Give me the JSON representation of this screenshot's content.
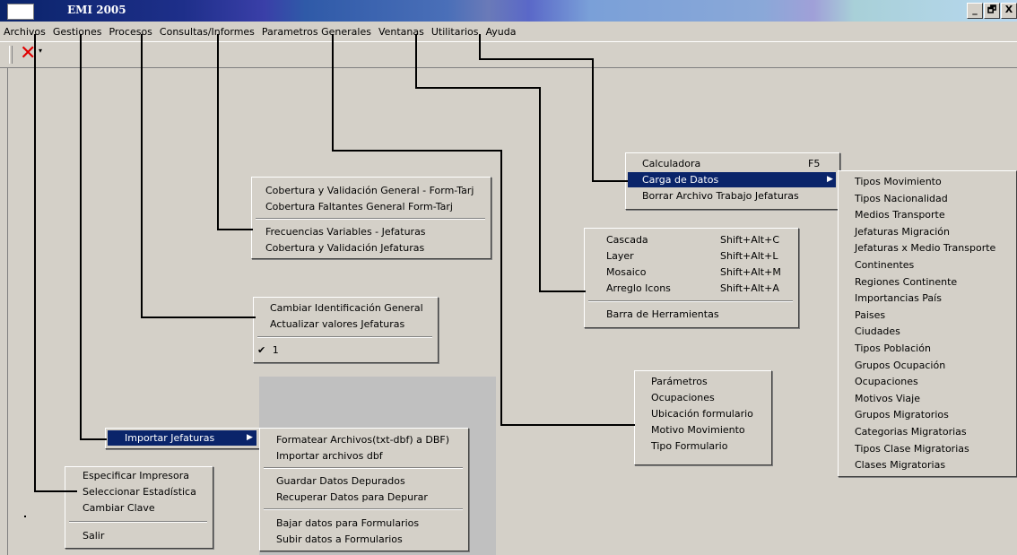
{
  "window": {
    "title": "EMI 2005",
    "buttons": [
      "_",
      "🗗",
      "X"
    ]
  },
  "menubar": [
    "Archivos",
    "Gestiones",
    "Procesos",
    "Consultas/Informes",
    "Parametros Generales",
    "Ventanas",
    "Utilitarios",
    "Ayuda"
  ],
  "toolbar": {
    "close_icon": "✕",
    "dropdown_icon": "▾"
  },
  "menus": {
    "utilitarios": {
      "items": [
        "Calculadora",
        "Carga de Datos",
        "Borrar Archivo Trabajo Jefaturas"
      ],
      "shortcut_calc": "F5"
    },
    "carga_de_datos": {
      "items": [
        "Tipos Movimiento",
        "Tipos Nacionalidad",
        "Medios Transporte",
        "Jefaturas Migración",
        "Jefaturas x Medio Transporte",
        "Continentes",
        "Regiones Continente",
        "Importancias País",
        "Paises",
        "Ciudades",
        "Tipos Población",
        "Grupos Ocupación",
        "Ocupaciones",
        "Motivos Viaje",
        "Grupos Migratorios",
        "Categorias Migratorias",
        "Tipos Clase Migratorias",
        "Clases Migratorias"
      ]
    },
    "consultas": {
      "items": [
        "Cobertura y Validación General - Form-Tarj",
        "Cobertura Faltantes General Form-Tarj",
        "Frecuencias Variables - Jefaturas",
        "Cobertura y Validación Jefaturas"
      ]
    },
    "ventanas": {
      "items": [
        "Cascada",
        "Layer",
        "Mosaico",
        "Arreglo Icons",
        "Barra de Herramientas"
      ],
      "shortcuts": [
        "Shift+Alt+C",
        "Shift+Alt+L",
        "Shift+Alt+M",
        "Shift+Alt+A"
      ]
    },
    "procesos": {
      "items": [
        "Cambiar Identificación General",
        "Actualizar valores Jefaturas",
        "1"
      ],
      "check": "✔"
    },
    "parametros": {
      "items": [
        "Parámetros",
        "Ocupaciones",
        "Ubicación formulario",
        "Motivo Movimiento",
        "Tipo Formulario"
      ]
    },
    "gestiones": {
      "items": [
        "Importar Jefaturas"
      ]
    },
    "importar": {
      "items": [
        "Formatear Archivos(txt-dbf) a DBF)",
        "Importar archivos dbf",
        "Guardar Datos Depurados",
        "Recuperar Datos para Depurar",
        "Bajar datos para Formularios",
        "Subir datos a Formularios"
      ]
    },
    "archivos": {
      "items": [
        "Especificar Impresora",
        "Seleccionar Estadística",
        "Cambiar Clave",
        "Salir"
      ]
    }
  }
}
